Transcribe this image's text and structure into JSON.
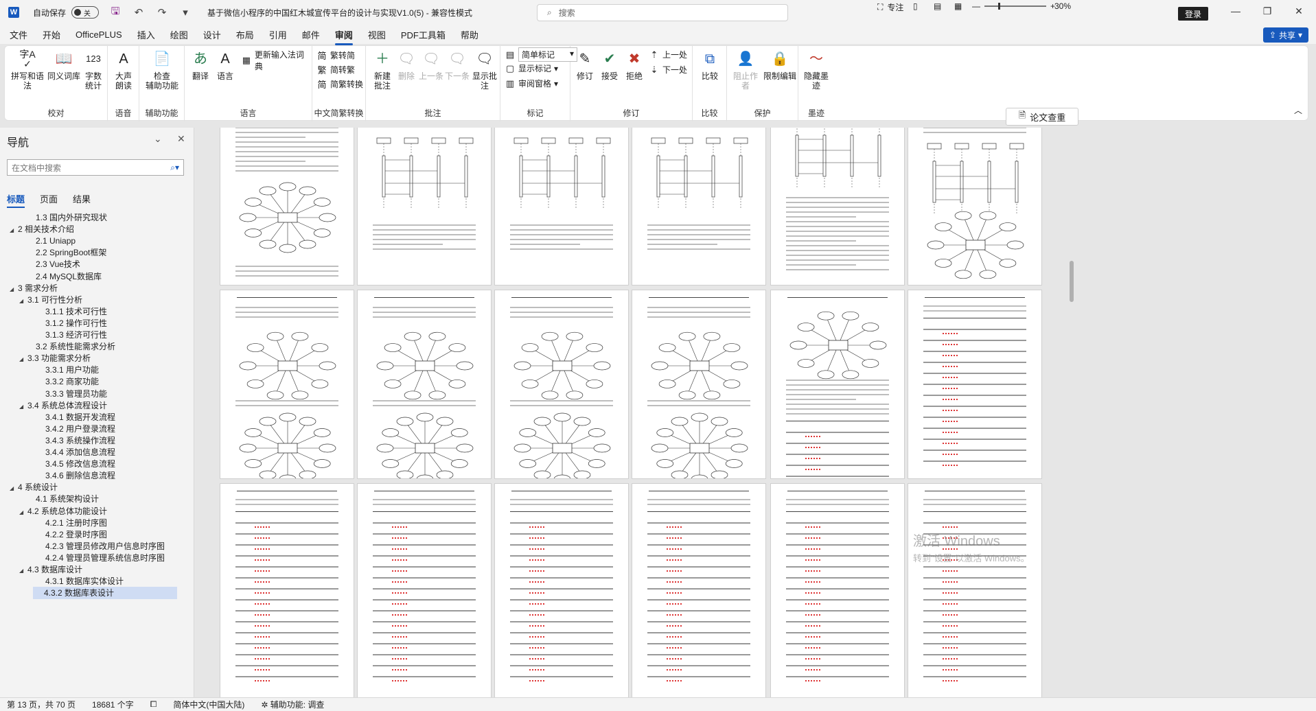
{
  "titlebar": {
    "autosave_label": "自动保存",
    "autosave_state": "关",
    "doc_title": "基于微信小程序的中国红木城宣传平台的设计与实现V1.0(5)  -  兼容性模式",
    "search_placeholder": "搜索",
    "login_label": "登录"
  },
  "menu": {
    "tabs": [
      "文件",
      "开始",
      "OfficePLUS",
      "插入",
      "绘图",
      "设计",
      "布局",
      "引用",
      "邮件",
      "审阅",
      "视图",
      "PDF工具箱",
      "帮助"
    ],
    "active_tab": "审阅",
    "share_label": "共享"
  },
  "ribbon": {
    "proofing": {
      "label": "校对",
      "spell": "拼写和语法",
      "thesaurus": "同义词库",
      "wordcount": "字数\n统计"
    },
    "speech": {
      "label": "语音",
      "read": "大声\n朗读"
    },
    "accessibility": {
      "label": "辅助功能",
      "check": "检查\n辅助功能"
    },
    "language": {
      "label": "语言",
      "translate": "翻译",
      "language": "语言",
      "ime": "更新输入法词典"
    },
    "chinese": {
      "label": "中文简繁转换",
      "to_trad": "繁转简",
      "to_simp": "简转繁",
      "convert": "简繁转换"
    },
    "comments": {
      "label": "批注",
      "new": "新建\n批注",
      "delete": "删除",
      "prev": "上一条",
      "next": "下一条",
      "show": "显示批注"
    },
    "tracking": {
      "label": "标记",
      "markup": "简单标记",
      "show_markup": "显示标记",
      "pane": "审阅窗格"
    },
    "changes": {
      "label": "修订",
      "track": "修订",
      "accept": "接受",
      "reject": "拒绝",
      "prev": "上一处",
      "next": "下一处"
    },
    "compare": {
      "label": "比较",
      "compare": "比较"
    },
    "protect": {
      "label": "保护",
      "block": "阻止作者",
      "restrict": "限制编辑"
    },
    "ink": {
      "label": "墨迹",
      "hide": "隐藏墨\n迹"
    }
  },
  "nav": {
    "title": "导航",
    "search_placeholder": "在文档中搜索",
    "tabs": [
      "标题",
      "页面",
      "结果"
    ],
    "active_tab": "标题",
    "items": [
      {
        "text": "1.3 国内外研究现状",
        "level": 2,
        "expand": ""
      },
      {
        "text": "2 相关技术介绍",
        "level": 1,
        "expand": "open"
      },
      {
        "text": "2.1 Uniapp",
        "level": 2,
        "expand": ""
      },
      {
        "text": "2.2 SpringBoot框架",
        "level": 2,
        "expand": ""
      },
      {
        "text": "2.3  Vue技术",
        "level": 2,
        "expand": ""
      },
      {
        "text": "2.4  MySQL数据库",
        "level": 2,
        "expand": ""
      },
      {
        "text": "3 需求分析",
        "level": 1,
        "expand": "open"
      },
      {
        "text": "3.1 可行性分析",
        "level": 2,
        "expand": "open"
      },
      {
        "text": "3.1.1 技术可行性",
        "level": 3,
        "expand": ""
      },
      {
        "text": "3.1.2 操作可行性",
        "level": 3,
        "expand": ""
      },
      {
        "text": "3.1.3 经济可行性",
        "level": 3,
        "expand": ""
      },
      {
        "text": "3.2 系统性能需求分析",
        "level": 2,
        "expand": ""
      },
      {
        "text": "3.3 功能需求分析",
        "level": 2,
        "expand": "open"
      },
      {
        "text": "3.3.1 用户功能",
        "level": 3,
        "expand": ""
      },
      {
        "text": "3.3.2 商家功能",
        "level": 3,
        "expand": ""
      },
      {
        "text": "3.3.3 管理员功能",
        "level": 3,
        "expand": ""
      },
      {
        "text": "3.4 系统总体流程设计",
        "level": 2,
        "expand": "open"
      },
      {
        "text": "3.4.1 数据开发流程",
        "level": 3,
        "expand": ""
      },
      {
        "text": "3.4.2 用户登录流程",
        "level": 3,
        "expand": ""
      },
      {
        "text": "3.4.3 系统操作流程",
        "level": 3,
        "expand": ""
      },
      {
        "text": "3.4.4 添加信息流程",
        "level": 3,
        "expand": ""
      },
      {
        "text": "3.4.5 修改信息流程",
        "level": 3,
        "expand": ""
      },
      {
        "text": "3.4.6 删除信息流程",
        "level": 3,
        "expand": ""
      },
      {
        "text": "4 系统设计",
        "level": 1,
        "expand": "open"
      },
      {
        "text": "4.1 系统架构设计",
        "level": 2,
        "expand": ""
      },
      {
        "text": "4.2 系统总体功能设计",
        "level": 2,
        "expand": "open"
      },
      {
        "text": "4.2.1 注册时序图",
        "level": 3,
        "expand": ""
      },
      {
        "text": "4.2.2 登录时序图",
        "level": 3,
        "expand": ""
      },
      {
        "text": "4.2.3 管理员修改用户信息时序图",
        "level": 3,
        "expand": ""
      },
      {
        "text": "4.2.4 管理员管理系统信息时序图",
        "level": 3,
        "expand": ""
      },
      {
        "text": "4.3 数据库设计",
        "level": 2,
        "expand": "open"
      },
      {
        "text": "4.3.1 数据库实体设计",
        "level": 3,
        "expand": ""
      },
      {
        "text": "4.3.2 数据库表设计",
        "level": 3,
        "expand": "",
        "selected": true
      }
    ]
  },
  "doc": {
    "side_button": "论文查重",
    "watermark_line1": "激活 Windows",
    "watermark_line2": "转到\"设置\"以激活 Windows。"
  },
  "statusbar": {
    "page": "第 13 页，共 70 页",
    "words": "18681 个字",
    "language": "简体中文(中国大陆)",
    "accessibility": "辅助功能: 调查",
    "focus": "专注",
    "zoom": "30%"
  },
  "colors": {
    "accent": "#185abd",
    "selected_nav": "#cfdcf3"
  }
}
